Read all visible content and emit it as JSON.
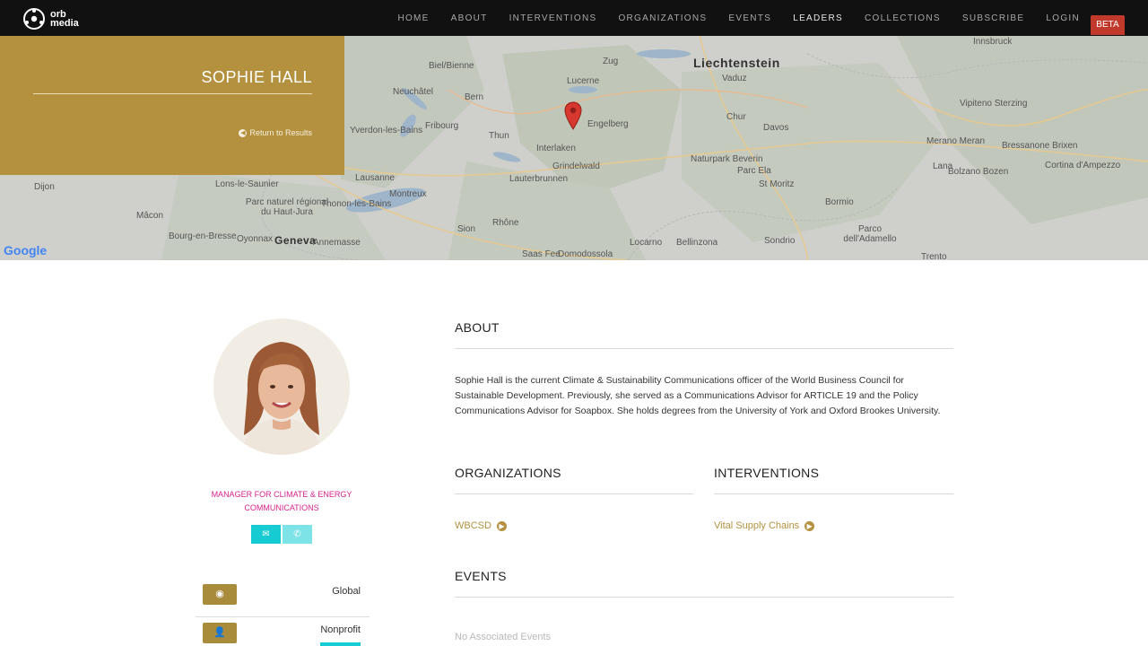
{
  "nav": {
    "logo_line1": "orb",
    "logo_line2": "media",
    "items": [
      {
        "label": "HOME"
      },
      {
        "label": "ABOUT"
      },
      {
        "label": "INTERVENTIONS"
      },
      {
        "label": "ORGANIZATIONS"
      },
      {
        "label": "EVENTS"
      },
      {
        "label": "LEADERS"
      },
      {
        "label": "COLLECTIONS"
      },
      {
        "label": "SUBSCRIBE"
      },
      {
        "label": "LOGIN"
      }
    ],
    "active": "LEADERS",
    "beta": "BETA"
  },
  "map": {
    "labels": {
      "zug": "Zug",
      "liechtenstein": "Liechtenstein",
      "innsbruck": "Innsbruck",
      "biel": "Biel/Bienne",
      "bern": "Bern",
      "lucerne": "Lucerne",
      "vaduz": "Vaduz",
      "neuchatel": "Neuchâtel",
      "fribourg": "Fribourg",
      "engelberg": "Engelberg",
      "chur": "Chur",
      "davos": "Davos",
      "interlaken": "Interlaken",
      "vipiteno": "Vipiteno Sterzing",
      "merano": "Merano Meran",
      "bressanone": "Bressanone Brixen",
      "lausanne": "Lausanne",
      "grindelwald": "Grindelwald",
      "naturpark": "Naturpark Beverin",
      "piz_ela": "Parc Ela",
      "bolzano": "Bolzano Bozen",
      "cortina": "Cortina d'Ampezzo",
      "dijon": "Dijon",
      "montreux": "Montreux",
      "lauterbrunnen": "Lauterbrunnen",
      "st_moritz": "St Moritz",
      "lana": "Lana",
      "macon": "Mâcon",
      "geneva": "Geneva",
      "thonon": "Thonon-les-Bains",
      "sion": "Sion",
      "bormio": "Bormio",
      "parc_jura": "Parc naturel régional du Haut-Jura",
      "bourg": "Bourg-en-Bresse",
      "oyonnax": "Oyonnax",
      "annemasse": "Annemasse",
      "locarno": "Locarno",
      "bellinzona": "Bellinzona",
      "sondrio": "Sondrio",
      "adamello": "Parco dell'Adamello",
      "rhone": "Rhône",
      "saas_fee": "Saas Fee",
      "domodossola": "Domodossola",
      "trento": "Trento",
      "lons": "Lons-le-Saunier",
      "yverdon": "Yverdon-les-Bains",
      "thun": "Thun"
    },
    "google": "Google"
  },
  "hero": {
    "name": "SOPHIE HALL",
    "return_label": "Return to Results"
  },
  "profile": {
    "role": "MANAGER FOR CLIMATE & ENERGY COMMUNICATIONS",
    "tags": [
      {
        "label": "Global",
        "icon": "globe-icon"
      },
      {
        "label": "Nonprofit",
        "icon": "person-icon"
      }
    ]
  },
  "about": {
    "title": "ABOUT",
    "text": "Sophie Hall is the current Climate & Sustainability Communications officer of the World Business Council for Sustainable Development. Previously, she served as a Communications Advisor for ARTICLE 19 and the Policy Communications Advisor for Soapbox. She holds degrees from the University of York and Oxford Brookes University."
  },
  "organizations": {
    "title": "ORGANIZATIONS",
    "items": [
      {
        "label": "WBCSD"
      }
    ]
  },
  "interventions": {
    "title": "INTERVENTIONS",
    "items": [
      {
        "label": "Vital Supply Chains"
      }
    ]
  },
  "events": {
    "title": "EVENTS",
    "empty": "No Associated Events"
  },
  "colors": {
    "gold": "#b3913f",
    "pink": "#d6248e",
    "teal": "#16cbd2",
    "beta": "#c0392b"
  }
}
